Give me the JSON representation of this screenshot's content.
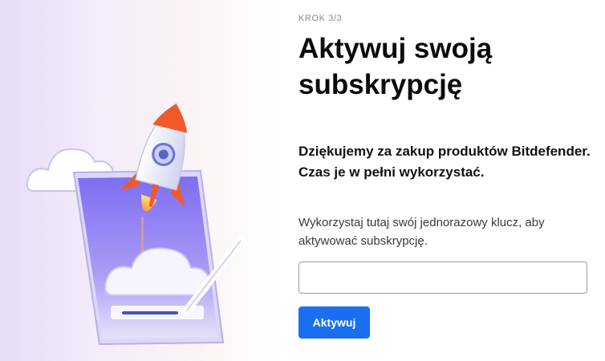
{
  "step": {
    "label": "KROK 3/3"
  },
  "heading": {
    "title": "Aktywuj swoją subskrypcję"
  },
  "message": {
    "thanks": "Dziękujemy za zakup produktów Bitdefender. Czas je w pełni wykorzystać."
  },
  "form": {
    "instruction": "Wykorzystaj tutaj swój jednorazowy klucz, aby aktywować subskrypcję.",
    "key_value": "",
    "key_placeholder": "",
    "submit_label": "Aktywuj"
  },
  "colors": {
    "accent": "#1a6ff0",
    "rocket_flame": "#f05a2a",
    "tablet": "#7a6cf0"
  },
  "icons": {
    "illustration": [
      "rocket-icon",
      "tablet-icon",
      "cloud-icon",
      "pen-icon"
    ]
  }
}
